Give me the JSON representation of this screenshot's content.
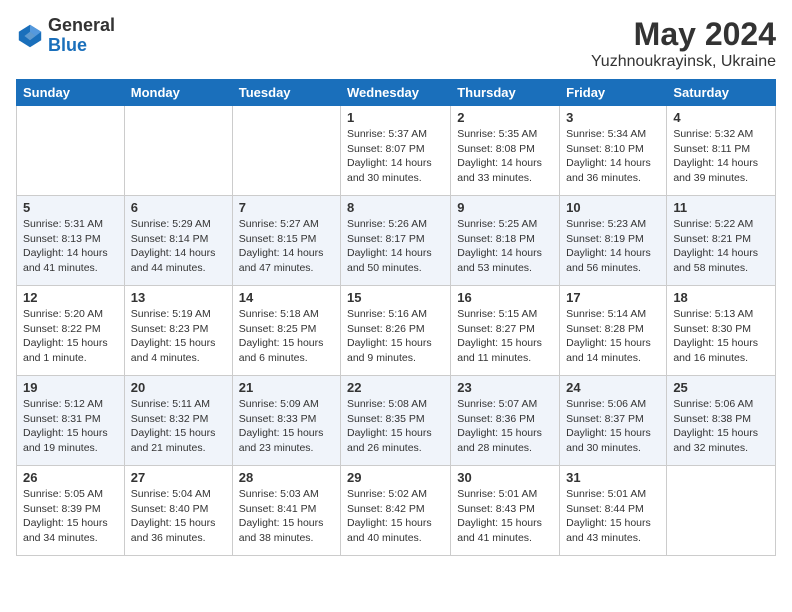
{
  "logo": {
    "general": "General",
    "blue": "Blue"
  },
  "title": "May 2024",
  "location": "Yuzhnoukrayinsk, Ukraine",
  "weekdays": [
    "Sunday",
    "Monday",
    "Tuesday",
    "Wednesday",
    "Thursday",
    "Friday",
    "Saturday"
  ],
  "weeks": [
    [
      {
        "day": "",
        "sunrise": "",
        "sunset": "",
        "daylight": ""
      },
      {
        "day": "",
        "sunrise": "",
        "sunset": "",
        "daylight": ""
      },
      {
        "day": "",
        "sunrise": "",
        "sunset": "",
        "daylight": ""
      },
      {
        "day": "1",
        "sunrise": "Sunrise: 5:37 AM",
        "sunset": "Sunset: 8:07 PM",
        "daylight": "Daylight: 14 hours and 30 minutes."
      },
      {
        "day": "2",
        "sunrise": "Sunrise: 5:35 AM",
        "sunset": "Sunset: 8:08 PM",
        "daylight": "Daylight: 14 hours and 33 minutes."
      },
      {
        "day": "3",
        "sunrise": "Sunrise: 5:34 AM",
        "sunset": "Sunset: 8:10 PM",
        "daylight": "Daylight: 14 hours and 36 minutes."
      },
      {
        "day": "4",
        "sunrise": "Sunrise: 5:32 AM",
        "sunset": "Sunset: 8:11 PM",
        "daylight": "Daylight: 14 hours and 39 minutes."
      }
    ],
    [
      {
        "day": "5",
        "sunrise": "Sunrise: 5:31 AM",
        "sunset": "Sunset: 8:13 PM",
        "daylight": "Daylight: 14 hours and 41 minutes."
      },
      {
        "day": "6",
        "sunrise": "Sunrise: 5:29 AM",
        "sunset": "Sunset: 8:14 PM",
        "daylight": "Daylight: 14 hours and 44 minutes."
      },
      {
        "day": "7",
        "sunrise": "Sunrise: 5:27 AM",
        "sunset": "Sunset: 8:15 PM",
        "daylight": "Daylight: 14 hours and 47 minutes."
      },
      {
        "day": "8",
        "sunrise": "Sunrise: 5:26 AM",
        "sunset": "Sunset: 8:17 PM",
        "daylight": "Daylight: 14 hours and 50 minutes."
      },
      {
        "day": "9",
        "sunrise": "Sunrise: 5:25 AM",
        "sunset": "Sunset: 8:18 PM",
        "daylight": "Daylight: 14 hours and 53 minutes."
      },
      {
        "day": "10",
        "sunrise": "Sunrise: 5:23 AM",
        "sunset": "Sunset: 8:19 PM",
        "daylight": "Daylight: 14 hours and 56 minutes."
      },
      {
        "day": "11",
        "sunrise": "Sunrise: 5:22 AM",
        "sunset": "Sunset: 8:21 PM",
        "daylight": "Daylight: 14 hours and 58 minutes."
      }
    ],
    [
      {
        "day": "12",
        "sunrise": "Sunrise: 5:20 AM",
        "sunset": "Sunset: 8:22 PM",
        "daylight": "Daylight: 15 hours and 1 minute."
      },
      {
        "day": "13",
        "sunrise": "Sunrise: 5:19 AM",
        "sunset": "Sunset: 8:23 PM",
        "daylight": "Daylight: 15 hours and 4 minutes."
      },
      {
        "day": "14",
        "sunrise": "Sunrise: 5:18 AM",
        "sunset": "Sunset: 8:25 PM",
        "daylight": "Daylight: 15 hours and 6 minutes."
      },
      {
        "day": "15",
        "sunrise": "Sunrise: 5:16 AM",
        "sunset": "Sunset: 8:26 PM",
        "daylight": "Daylight: 15 hours and 9 minutes."
      },
      {
        "day": "16",
        "sunrise": "Sunrise: 5:15 AM",
        "sunset": "Sunset: 8:27 PM",
        "daylight": "Daylight: 15 hours and 11 minutes."
      },
      {
        "day": "17",
        "sunrise": "Sunrise: 5:14 AM",
        "sunset": "Sunset: 8:28 PM",
        "daylight": "Daylight: 15 hours and 14 minutes."
      },
      {
        "day": "18",
        "sunrise": "Sunrise: 5:13 AM",
        "sunset": "Sunset: 8:30 PM",
        "daylight": "Daylight: 15 hours and 16 minutes."
      }
    ],
    [
      {
        "day": "19",
        "sunrise": "Sunrise: 5:12 AM",
        "sunset": "Sunset: 8:31 PM",
        "daylight": "Daylight: 15 hours and 19 minutes."
      },
      {
        "day": "20",
        "sunrise": "Sunrise: 5:11 AM",
        "sunset": "Sunset: 8:32 PM",
        "daylight": "Daylight: 15 hours and 21 minutes."
      },
      {
        "day": "21",
        "sunrise": "Sunrise: 5:09 AM",
        "sunset": "Sunset: 8:33 PM",
        "daylight": "Daylight: 15 hours and 23 minutes."
      },
      {
        "day": "22",
        "sunrise": "Sunrise: 5:08 AM",
        "sunset": "Sunset: 8:35 PM",
        "daylight": "Daylight: 15 hours and 26 minutes."
      },
      {
        "day": "23",
        "sunrise": "Sunrise: 5:07 AM",
        "sunset": "Sunset: 8:36 PM",
        "daylight": "Daylight: 15 hours and 28 minutes."
      },
      {
        "day": "24",
        "sunrise": "Sunrise: 5:06 AM",
        "sunset": "Sunset: 8:37 PM",
        "daylight": "Daylight: 15 hours and 30 minutes."
      },
      {
        "day": "25",
        "sunrise": "Sunrise: 5:06 AM",
        "sunset": "Sunset: 8:38 PM",
        "daylight": "Daylight: 15 hours and 32 minutes."
      }
    ],
    [
      {
        "day": "26",
        "sunrise": "Sunrise: 5:05 AM",
        "sunset": "Sunset: 8:39 PM",
        "daylight": "Daylight: 15 hours and 34 minutes."
      },
      {
        "day": "27",
        "sunrise": "Sunrise: 5:04 AM",
        "sunset": "Sunset: 8:40 PM",
        "daylight": "Daylight: 15 hours and 36 minutes."
      },
      {
        "day": "28",
        "sunrise": "Sunrise: 5:03 AM",
        "sunset": "Sunset: 8:41 PM",
        "daylight": "Daylight: 15 hours and 38 minutes."
      },
      {
        "day": "29",
        "sunrise": "Sunrise: 5:02 AM",
        "sunset": "Sunset: 8:42 PM",
        "daylight": "Daylight: 15 hours and 40 minutes."
      },
      {
        "day": "30",
        "sunrise": "Sunrise: 5:01 AM",
        "sunset": "Sunset: 8:43 PM",
        "daylight": "Daylight: 15 hours and 41 minutes."
      },
      {
        "day": "31",
        "sunrise": "Sunrise: 5:01 AM",
        "sunset": "Sunset: 8:44 PM",
        "daylight": "Daylight: 15 hours and 43 minutes."
      },
      {
        "day": "",
        "sunrise": "",
        "sunset": "",
        "daylight": ""
      }
    ]
  ]
}
